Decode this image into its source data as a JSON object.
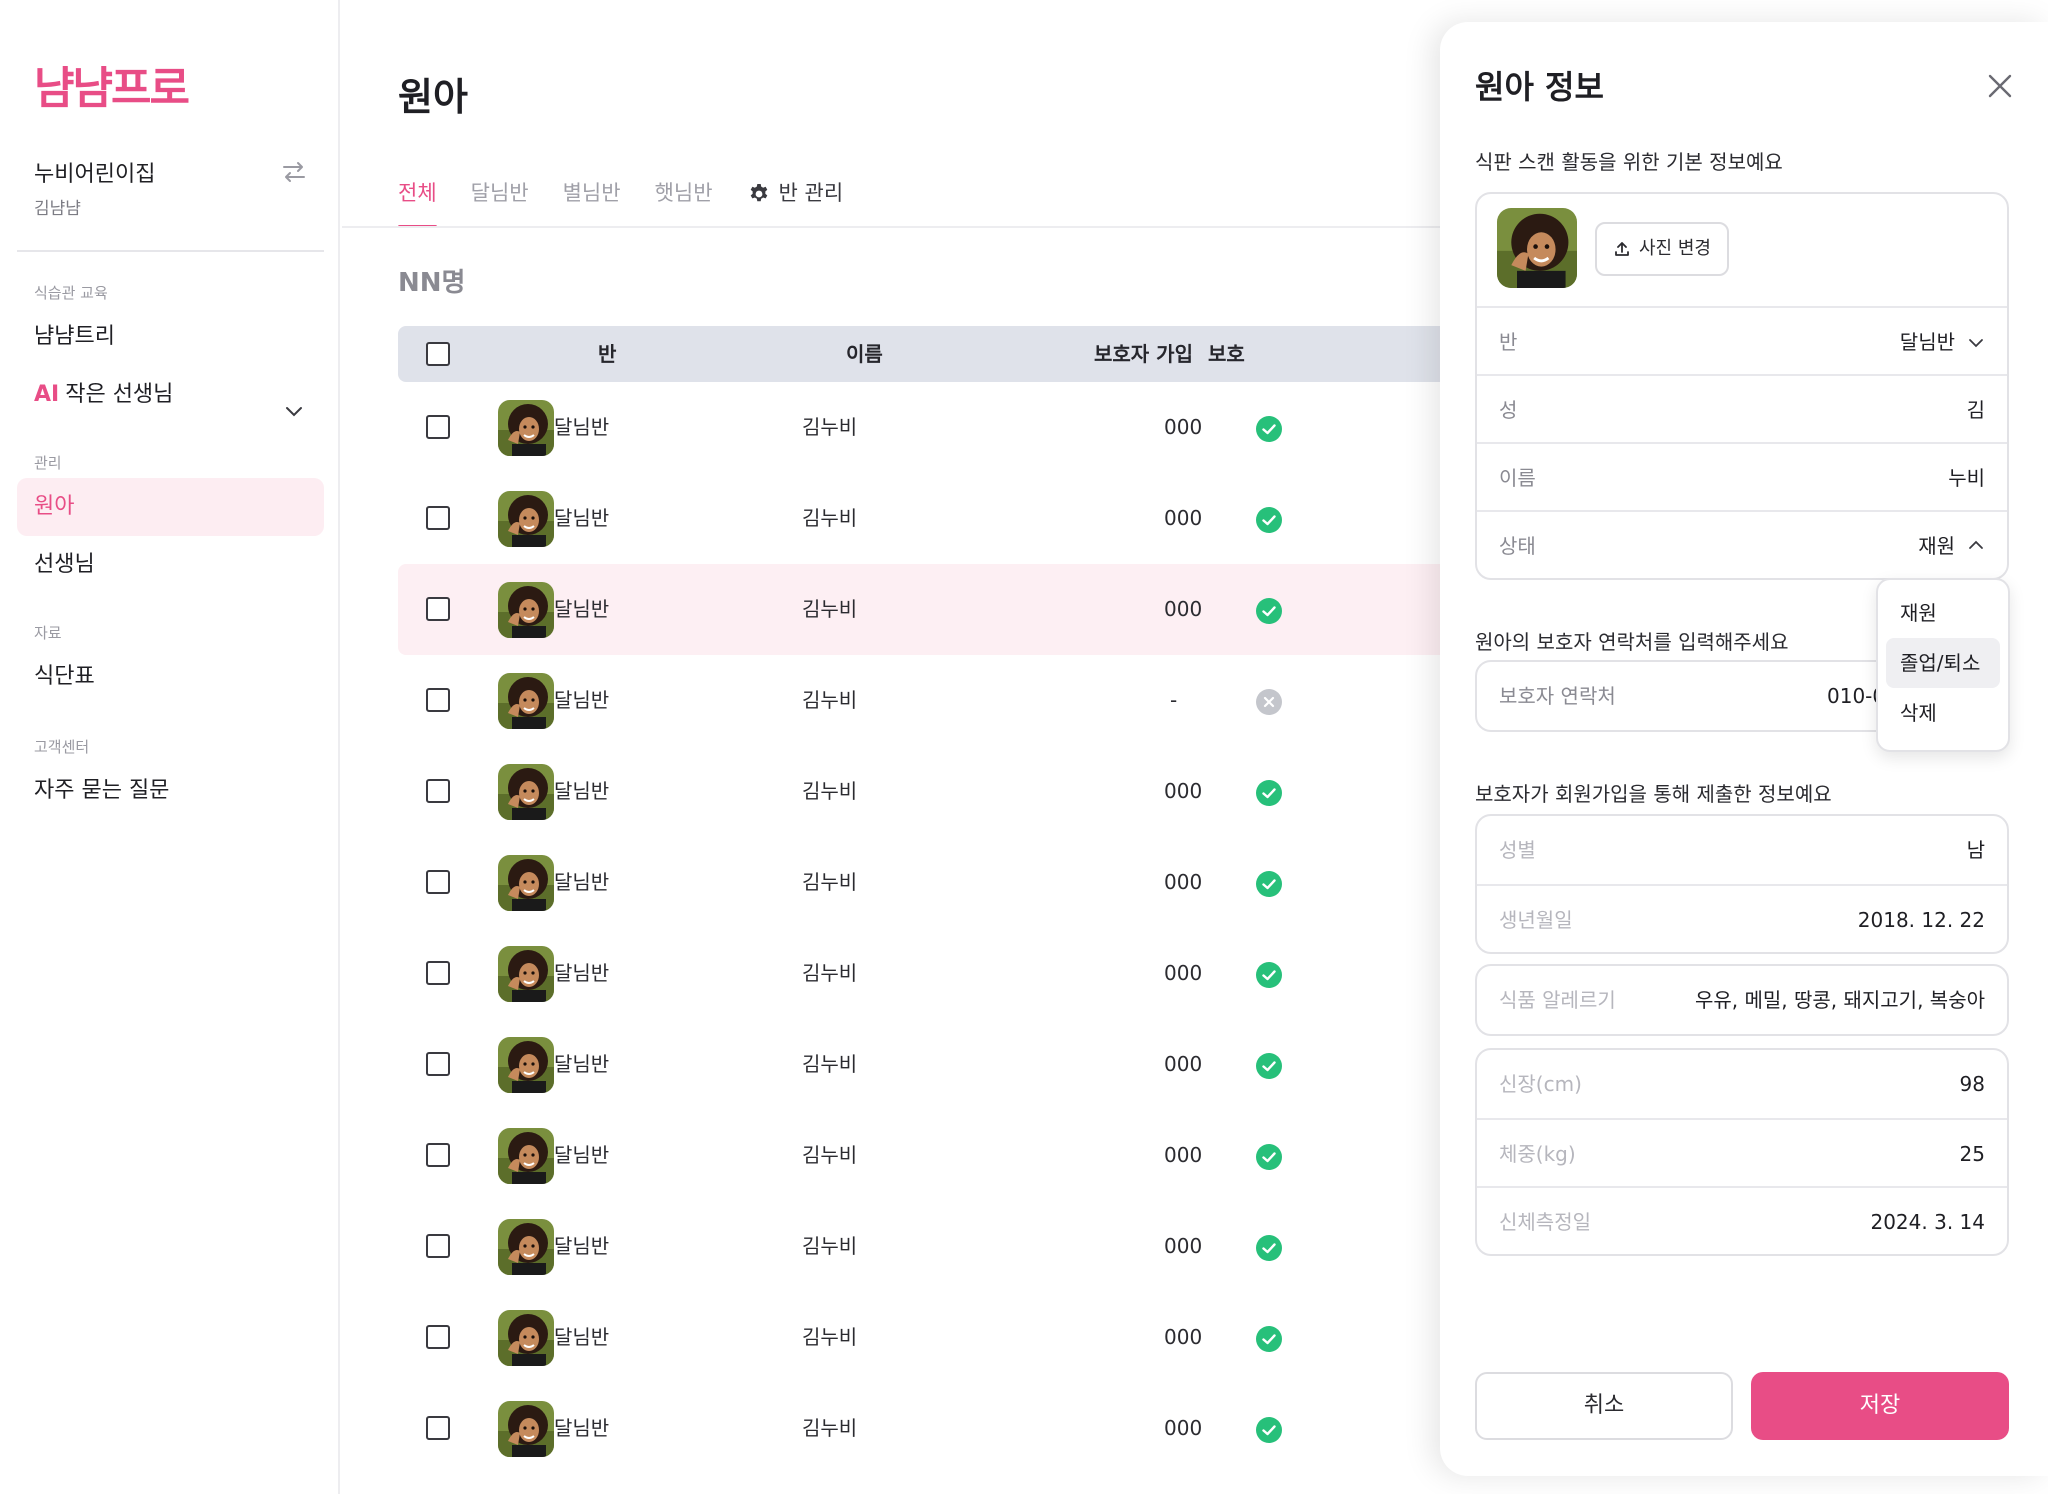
{
  "brand": {
    "logo_text": "냠냠프로",
    "accent_color": "#e84d86"
  },
  "sidebar": {
    "org_name": "누비어린이집",
    "user_name": "김냠냠",
    "switch_icon": "swap-arrows-icon",
    "sections": [
      {
        "title": "식습관 교육",
        "items": [
          {
            "label": "냠냠트리"
          },
          {
            "ai_prefix": "AI",
            "label": "작은 선생님"
          }
        ]
      },
      {
        "title": "관리",
        "items": [
          {
            "label": "원아",
            "active": true
          },
          {
            "label": "선생님"
          }
        ]
      },
      {
        "title": "자료",
        "items": [
          {
            "label": "식단표"
          }
        ]
      },
      {
        "title": "고객센터",
        "items": [
          {
            "label": "자주 묻는 질문"
          }
        ]
      }
    ]
  },
  "main": {
    "title": "원아",
    "tabs": [
      {
        "label": "전체",
        "active": true
      },
      {
        "label": "달님반"
      },
      {
        "label": "별님반"
      },
      {
        "label": "햇님반"
      }
    ],
    "manage_tab": "반 관리",
    "count_label": "NN명",
    "table": {
      "headers": {
        "class": "반",
        "name": "이름",
        "guardian_join": "보호자 가입",
        "guardian_contact": "보호"
      },
      "rows": [
        {
          "class": "달님반",
          "name": "김누비",
          "joined": true,
          "contact": "000"
        },
        {
          "class": "달님반",
          "name": "김누비",
          "joined": true,
          "contact": "000"
        },
        {
          "class": "달님반",
          "name": "김누비",
          "joined": true,
          "contact": "000"
        },
        {
          "class": "달님반",
          "name": "김누비",
          "joined": false,
          "contact": "-"
        },
        {
          "class": "달님반",
          "name": "김누비",
          "joined": true,
          "contact": "000"
        },
        {
          "class": "달님반",
          "name": "김누비",
          "joined": true,
          "contact": "000"
        },
        {
          "class": "달님반",
          "name": "김누비",
          "joined": true,
          "contact": "000"
        },
        {
          "class": "달님반",
          "name": "김누비",
          "joined": true,
          "contact": "000"
        },
        {
          "class": "달님반",
          "name": "김누비",
          "joined": true,
          "contact": "000"
        },
        {
          "class": "달님반",
          "name": "김누비",
          "joined": true,
          "contact": "000"
        },
        {
          "class": "달님반",
          "name": "김누비",
          "joined": true,
          "contact": "000"
        },
        {
          "class": "달님반",
          "name": "김누비",
          "joined": true,
          "contact": "000"
        }
      ]
    }
  },
  "drawer": {
    "title": "원아 정보",
    "basic_subtitle": "식판 스캔 활동을 위한 기본 정보예요",
    "photo_button": "사진 변경",
    "fields": {
      "class": {
        "label": "반",
        "value": "달님반"
      },
      "surname": {
        "label": "성",
        "value": "김"
      },
      "given_name": {
        "label": "이름",
        "value": "누비"
      },
      "status": {
        "label": "상태",
        "value": "재원"
      }
    },
    "status_options": [
      "재원",
      "졸업/퇴소",
      "삭제"
    ],
    "contact_subtitle": "원아의 보호자 연락처를 입력해주세요",
    "contact": {
      "label": "보호자 연락처",
      "value": "010-0"
    },
    "guardian_subtitle": "보호자가 회원가입을 통해 제출한 정보예요",
    "guardian_info": {
      "gender": {
        "label": "성별",
        "value": "남"
      },
      "birthday": {
        "label": "생년월일",
        "value": "2018. 12. 22"
      },
      "allergy": {
        "label": "식품 알레르기",
        "value": "우유, 메밀, 땅콩, 돼지고기, 복숭아"
      },
      "height": {
        "label": "신장(cm)",
        "value": "98"
      },
      "weight": {
        "label": "체중(kg)",
        "value": "25"
      },
      "measured": {
        "label": "신체측정일",
        "value": "2024. 3. 14"
      }
    },
    "cancel_label": "취소",
    "save_label": "저장"
  }
}
